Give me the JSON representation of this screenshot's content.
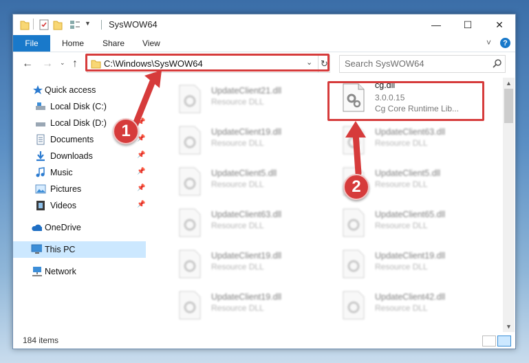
{
  "window": {
    "title": "SysWOW64",
    "controls": {
      "minimize": "—",
      "maximize": "☐",
      "close": "✕"
    }
  },
  "ribbon": {
    "tabs": [
      "File",
      "Home",
      "Share",
      "View"
    ],
    "expand": "˅",
    "help": "?"
  },
  "address": {
    "path": "C:\\Windows\\SysWOW64",
    "search_placeholder": "Search SysWOW64"
  },
  "nav": {
    "quick_access": "Quick access",
    "items": [
      {
        "label": "Local Disk (C:)",
        "icon": "drive-icon",
        "pinned": false
      },
      {
        "label": "Local Disk (D:)",
        "icon": "drive-icon",
        "pinned": true
      },
      {
        "label": "Documents",
        "icon": "documents-icon",
        "pinned": true
      },
      {
        "label": "Downloads",
        "icon": "downloads-icon",
        "pinned": true
      },
      {
        "label": "Music",
        "icon": "music-icon",
        "pinned": true
      },
      {
        "label": "Pictures",
        "icon": "pictures-icon",
        "pinned": true
      },
      {
        "label": "Videos",
        "icon": "videos-icon",
        "pinned": true
      }
    ],
    "onedrive": "OneDrive",
    "this_pc": "This PC",
    "network": "Network"
  },
  "files": {
    "featured": {
      "name": "cg.dll",
      "version": "3.0.0.15",
      "description": "Cg Core Runtime Lib..."
    },
    "left_column": [
      {
        "name": "UpdateClient21.dll",
        "type": "Resource DLL"
      },
      {
        "name": "UpdateClient19.dll",
        "type": "Resource DLL"
      },
      {
        "name": "UpdateClient5.dll",
        "type": "Resource DLL"
      },
      {
        "name": "UpdateClient63.dll",
        "type": "Resource DLL"
      },
      {
        "name": "UpdateClient19.dll",
        "type": "Resource DLL"
      },
      {
        "name": "UpdateClient19.dll",
        "type": "Resource DLL"
      }
    ],
    "right_column": [
      {
        "name": "UpdateClient63.dll",
        "type": "Resource DLL"
      },
      {
        "name": "UpdateClient5.dll",
        "type": "Resource DLL"
      },
      {
        "name": "UpdateClient65.dll",
        "type": "Resource DLL"
      },
      {
        "name": "UpdateClient19.dll",
        "type": "Resource DLL"
      },
      {
        "name": "UpdateClient42.dll",
        "type": "Resource DLL"
      }
    ]
  },
  "status": {
    "count": "184 items"
  },
  "annotations": {
    "step1": "1",
    "step2": "2",
    "color": "#d63b3b"
  }
}
